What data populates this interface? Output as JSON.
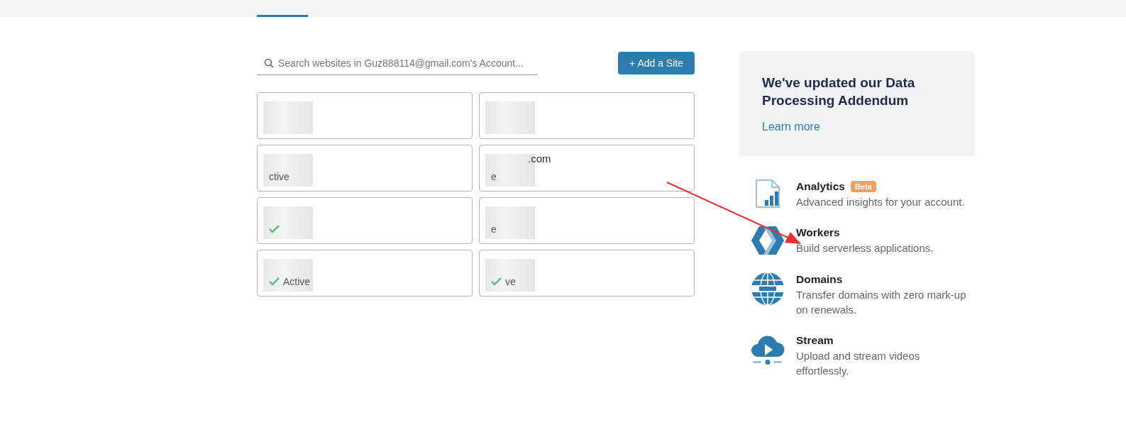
{
  "tabs": [
    {
      "selected": true
    }
  ],
  "search": {
    "placeholder": "Search websites in Guz888114@gmail.com's Account..."
  },
  "add_button": "+ Add a Site",
  "sites": [
    {
      "checked": false
    },
    {
      "status": "ctive",
      "checked": false
    },
    {
      "checked": true
    },
    {
      "status": "Active",
      "checked": true
    },
    {
      "checked": false
    },
    {
      "name": ".com",
      "status": "e",
      "checked": false
    },
    {
      "status": "e",
      "checked": false
    },
    {
      "status": "ve",
      "checked": true
    }
  ],
  "notice": {
    "title": "We've updated our Data Processing Addendum",
    "link": "Learn more"
  },
  "services": [
    {
      "kind": "analytics",
      "title": "Analytics",
      "badge": "Beta",
      "description": "Advanced insights for your account."
    },
    {
      "kind": "workers",
      "title": "Workers",
      "description": "Build serverless applications."
    },
    {
      "kind": "domains",
      "title": "Domains",
      "description": "Transfer domains with zero mark-up on renewals."
    },
    {
      "kind": "stream",
      "title": "Stream",
      "description": "Upload and stream videos effortlessly."
    }
  ]
}
